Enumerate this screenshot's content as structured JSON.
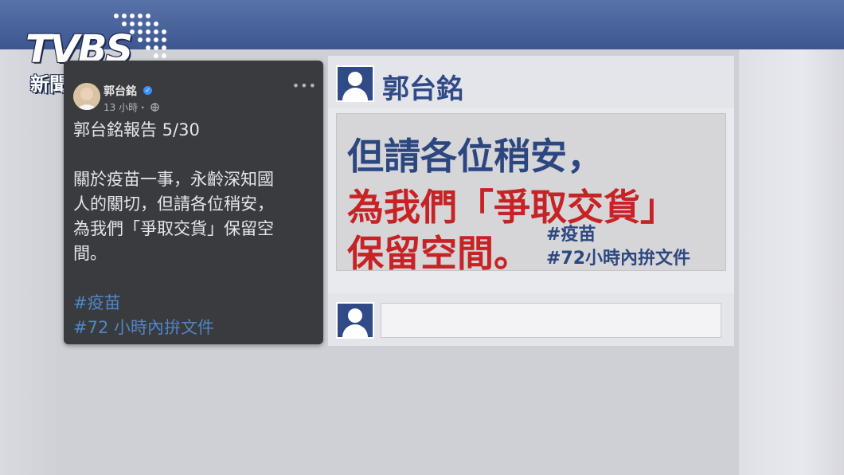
{
  "logo": {
    "brand": "TVBS",
    "subtitle": "新聞網"
  },
  "fb_post": {
    "author": "郭台銘",
    "verified_mark": "✓",
    "time": "13 小時・",
    "globe_icon": "globe-icon",
    "more_label": "•••",
    "title": "郭台銘報告 5/30",
    "body_lines": [
      "關於疫苗一事，永齡深知國",
      "人的關切，但請各位稍安，",
      "為我們「爭取交貨」保留空",
      "間。"
    ],
    "hashtags": [
      "#疫苗",
      "#72 小時內拚文件"
    ]
  },
  "quote_panel": {
    "name": "郭台銘",
    "line1": "但請各位稍安，",
    "line2": "為我們「爭取交貨」",
    "line3": "保留空間。",
    "tags": [
      "#疫苗",
      "#72小時內拚文件"
    ]
  },
  "colors": {
    "navy": "#2f4a86",
    "red": "#c62326",
    "fb_bg": "#3a3b3e",
    "hashtag": "#4f86c6"
  }
}
